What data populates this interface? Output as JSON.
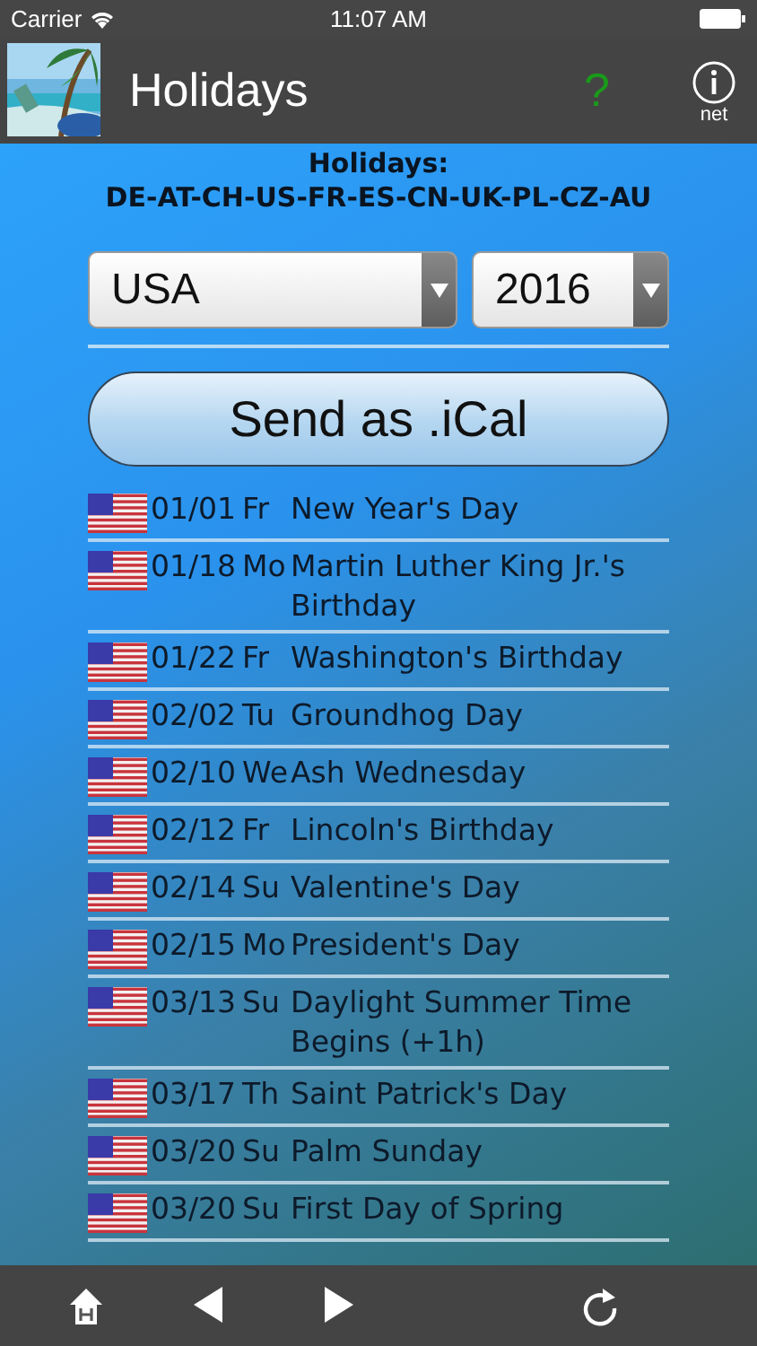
{
  "status_bar": {
    "carrier": "Carrier",
    "time": "11:07 AM"
  },
  "nav_bar": {
    "title": "Holidays",
    "help": "?",
    "info_label": "net"
  },
  "header": {
    "title": "Holidays:",
    "countries": "DE-AT-CH-US-FR-ES-CN-UK-PL-CZ-AU"
  },
  "country_select": {
    "value": "USA"
  },
  "year_select": {
    "value": "2016"
  },
  "send_button": {
    "label": "Send as .iCal"
  },
  "holidays": [
    {
      "date": "01/01",
      "weekday": "Fr",
      "name": "New Year's Day"
    },
    {
      "date": "01/18",
      "weekday": "Mo",
      "name": "Martin Luther King Jr.'s Birthday"
    },
    {
      "date": "01/22",
      "weekday": "Fr",
      "name": "Washington's Birthday"
    },
    {
      "date": "02/02",
      "weekday": "Tu",
      "name": "Groundhog Day"
    },
    {
      "date": "02/10",
      "weekday": "We",
      "name": "Ash Wednesday"
    },
    {
      "date": "02/12",
      "weekday": "Fr",
      "name": "Lincoln's Birthday"
    },
    {
      "date": "02/14",
      "weekday": "Su",
      "name": "Valentine's Day"
    },
    {
      "date": "02/15",
      "weekday": "Mo",
      "name": "President's Day"
    },
    {
      "date": "03/13",
      "weekday": "Su",
      "name": "Daylight Summer Time Begins (+1h)"
    },
    {
      "date": "03/17",
      "weekday": "Th",
      "name": "Saint Patrick's Day"
    },
    {
      "date": "03/20",
      "weekday": "Su",
      "name": "Palm Sunday"
    },
    {
      "date": "03/20",
      "weekday": "Su",
      "name": "First Day of Spring"
    }
  ]
}
